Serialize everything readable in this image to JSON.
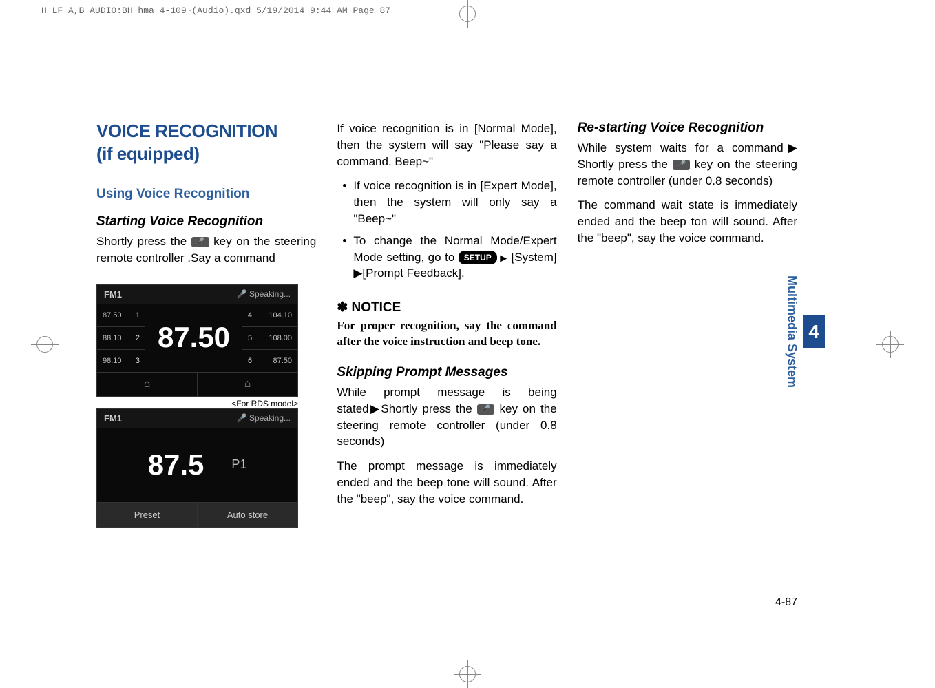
{
  "header": {
    "file_info": "H_LF_A,B_AUDIO:BH hma 4-109~(Audio).qxd  5/19/2014  9:44 AM  Page 87"
  },
  "col1": {
    "section_title_line1": "VOICE RECOGNITION",
    "section_title_line2": "(if equipped)",
    "heading1": "Using Voice Recognition",
    "heading2": "Starting Voice Recognition",
    "para1_pre": "Shortly press the ",
    "para1_post": " key on the steering remote controller .Say a command",
    "radio1": {
      "band": "FM1",
      "speaking": "Speaking...",
      "main_freq": "87.50",
      "left_presets": [
        {
          "freq": "87.50",
          "num": "1"
        },
        {
          "freq": "88.10",
          "num": "2"
        },
        {
          "freq": "98.10",
          "num": "3"
        }
      ],
      "right_presets": [
        {
          "num": "4",
          "freq": "104.10"
        },
        {
          "num": "5",
          "freq": "108.00"
        },
        {
          "num": "6",
          "freq": "87.50"
        }
      ]
    },
    "rds_caption": "<For RDS model>",
    "radio2": {
      "band": "FM1",
      "speaking": "Speaking...",
      "freq": "87.5",
      "p_label": "P1",
      "btn1": "Preset",
      "btn2": "Auto store"
    }
  },
  "col2": {
    "para1": "If voice recognition is in [Normal Mode], then the system will say \"Please say a command. Beep~\"",
    "bullet1": "If voice recognition is in [Expert Mode], then the system will only say a \"Beep~\"",
    "bullet2_pre": "To change the Normal Mode/Expert Mode setting, go to ",
    "bullet2_post": "[System] ▶[Prompt Feedback].",
    "setup_label": "SETUP",
    "notice_star": "✽",
    "notice_label": "NOTICE",
    "notice_text": "For proper recognition, say the command after the voice instruction and beep tone.",
    "heading3": "Skipping Prompt Messages",
    "para3_pre": "While prompt message is being stated▶Shortly press the ",
    "para3_post": " key on the steering remote controller (under 0.8 seconds)",
    "para4": "The prompt message is immediately ended and the beep tone will sound. After the \"beep\", say the voice command."
  },
  "col3": {
    "heading4": "Re-starting Voice Recognition",
    "para5_pre": "While system waits for a command▶ Shortly press the ",
    "para5_post": " key on the steering remote controller (under 0.8 seconds)",
    "para6": "The command wait state is immediately ended and the beep ton will sound. After the \"beep\", say the voice command."
  },
  "side_tab": {
    "number": "4",
    "label": "Multimedia System"
  },
  "page_number": "4-87",
  "key_icon_glyph": "🎤"
}
